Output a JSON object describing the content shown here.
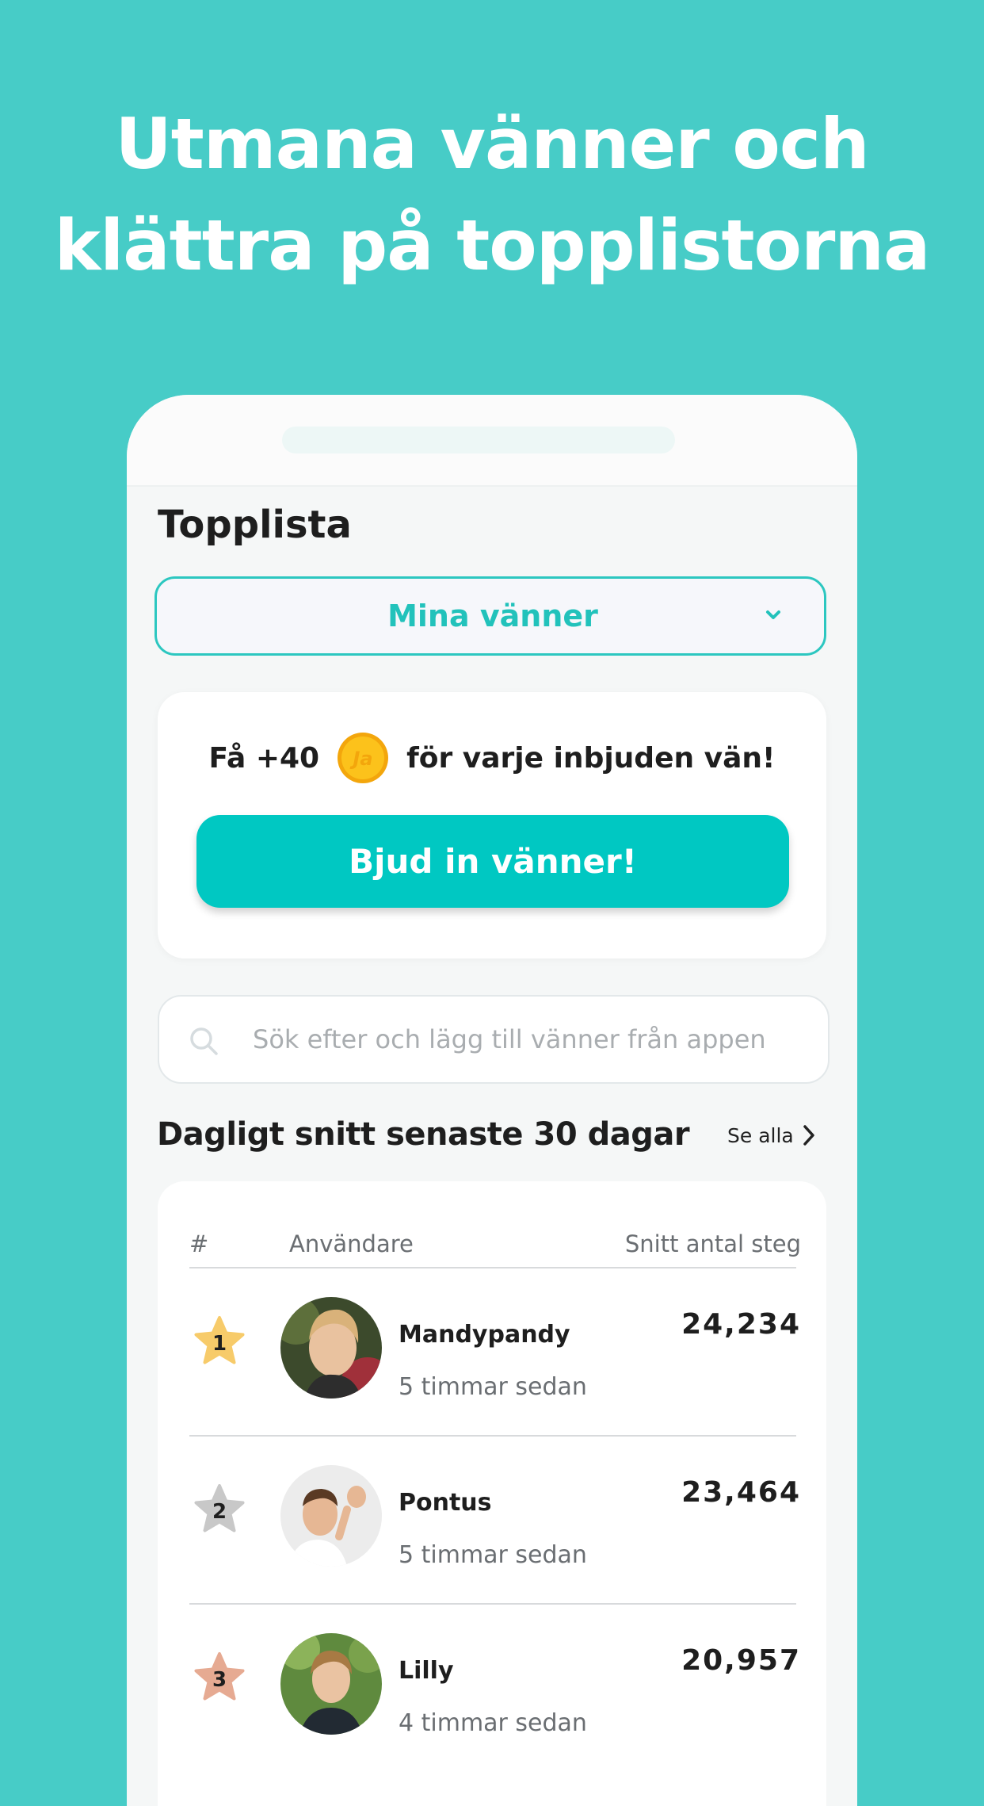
{
  "headline": {
    "line1": "Utmana  vänner och",
    "line2": "klättra på topplistorna"
  },
  "leaderboard": {
    "title": "Topplista",
    "filter": {
      "selected": "Mina vänner"
    },
    "invite": {
      "prefix": "Få +40",
      "coin_label": "Ja",
      "suffix": "för varje inbjuden vän!",
      "button_label": "Bjud in vänner!"
    },
    "search": {
      "placeholder": "Sök efter och lägg till vänner från appen"
    },
    "section": {
      "title": "Dagligt snitt senaste 30 dagar",
      "see_all": "Se alla"
    },
    "table": {
      "headers": {
        "rank": "#",
        "user": "Användare",
        "steps": "Snitt antal steg"
      },
      "rows": [
        {
          "rank": "1",
          "name": "Mandypandy",
          "time": "5 timmar sedan",
          "steps": "24,234",
          "star_color": "#f7cb6a"
        },
        {
          "rank": "2",
          "name": "Pontus",
          "time": "5 timmar sedan",
          "steps": "23,464",
          "star_color": "#c8c8c8"
        },
        {
          "rank": "3",
          "name": "Lilly",
          "time": "4 timmar sedan",
          "steps": "20,957",
          "star_color": "#e6aa92"
        }
      ]
    }
  },
  "colors": {
    "background": "#47ccc7",
    "accent": "#00c8c2",
    "coin": "#f9b812"
  }
}
